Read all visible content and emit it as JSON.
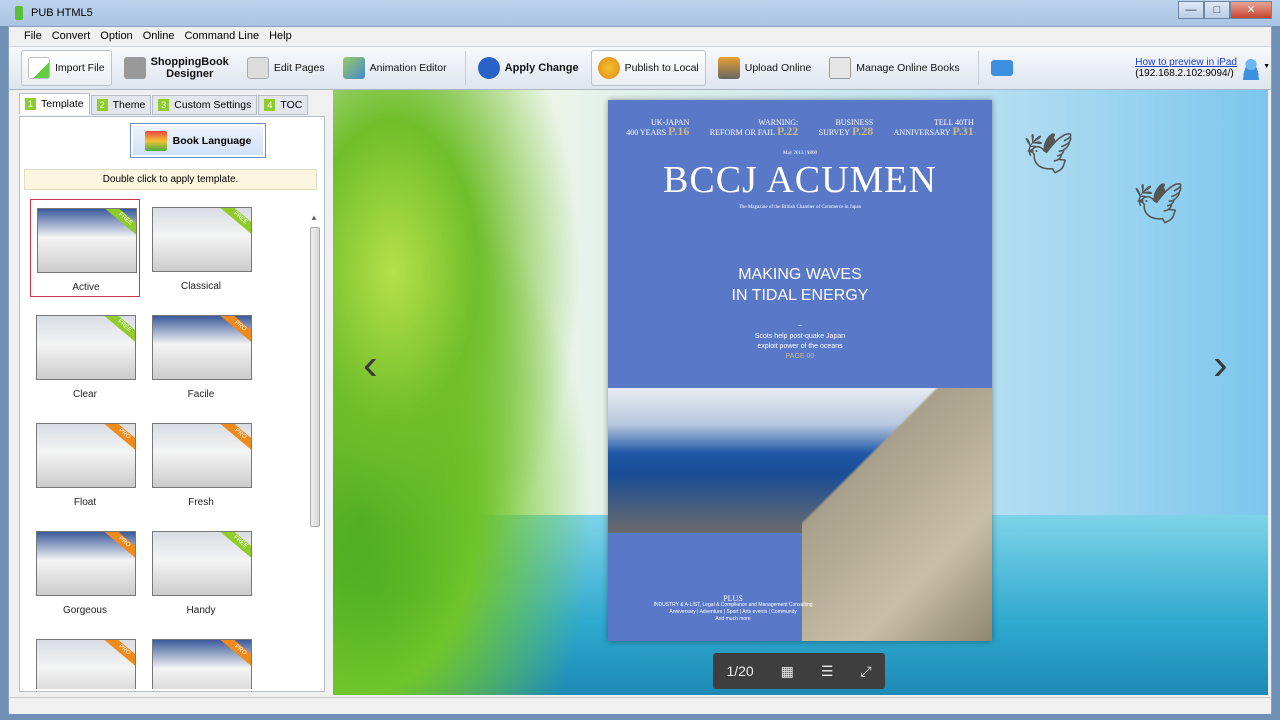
{
  "window": {
    "title": "PUB HTML5",
    "minimize": "—",
    "maximize": "□",
    "close": "✕"
  },
  "menu": [
    "File",
    "Convert",
    "Option",
    "Online",
    "Command Line",
    "Help"
  ],
  "toolbar": {
    "import": "Import File",
    "shopping1": "ShoppingBook",
    "shopping2": "Designer",
    "edit": "Edit Pages",
    "animation": "Animation Editor",
    "apply": "Apply Change",
    "publish": "Publish to Local",
    "upload": "Upload Online",
    "manage": "Manage Online Books",
    "preview_link": "How to preview in iPad",
    "preview_addr": "(192.168.2.102:9094/)"
  },
  "tabs": [
    {
      "num": "1",
      "label": "Template"
    },
    {
      "num": "2",
      "label": "Theme"
    },
    {
      "num": "3",
      "label": "Custom Settings"
    },
    {
      "num": "4",
      "label": "TOC"
    }
  ],
  "panel": {
    "book_language": "Book Language",
    "hint": "Double click to apply template."
  },
  "templates": [
    {
      "name": "Active",
      "badge": "FREE",
      "color": "#8fcc2a"
    },
    {
      "name": "Classical",
      "badge": "FREE",
      "color": "#8fcc2a"
    },
    {
      "name": "Clear",
      "badge": "FREE",
      "color": "#8fcc2a"
    },
    {
      "name": "Facile",
      "badge": "PRO",
      "color": "#f08a1c"
    },
    {
      "name": "Float",
      "badge": "PRO",
      "color": "#f08a1c"
    },
    {
      "name": "Fresh",
      "badge": "PRO",
      "color": "#f08a1c"
    },
    {
      "name": "Gorgeous",
      "badge": "PRO",
      "color": "#f08a1c"
    },
    {
      "name": "Handy",
      "badge": "FREE",
      "color": "#8fcc2a"
    },
    {
      "name": "",
      "badge": "PRO",
      "color": "#f08a1c"
    },
    {
      "name": "",
      "badge": "PRO",
      "color": "#f08a1c"
    }
  ],
  "book": {
    "tops": [
      [
        "UK-JAPAN",
        "400 YEARS",
        "P.16"
      ],
      [
        "WARNING:",
        "REFORM OR FAIL",
        "P.22"
      ],
      [
        "BUSINESS",
        "SURVEY",
        "P.28"
      ],
      [
        "TELL 40TH",
        "ANNIVERSARY",
        "P.31"
      ]
    ],
    "date": "May 2013 | ¥800",
    "masthead": "BCCJ ACUMEN",
    "tagline": "The Magazine of the British Chamber of Commerce in Japan",
    "headline1": "MAKING WAVES",
    "headline2": "IN TIDAL ENERGY",
    "tilde": "~",
    "sub1": "Scots help post-quake Japan",
    "sub2": "exploit power of the oceans",
    "sub3": "PAGE 00",
    "plus": "PLUS",
    "plus1": "INDUSTRY & A-LIST, Legal & Compliance and Management Consulting",
    "plus2": "Anniversary | Adventure | Sport | Arts events | Community",
    "plus3": "And much more"
  },
  "viewer": {
    "page": "1/20",
    "prev": "‹",
    "next": "›"
  }
}
